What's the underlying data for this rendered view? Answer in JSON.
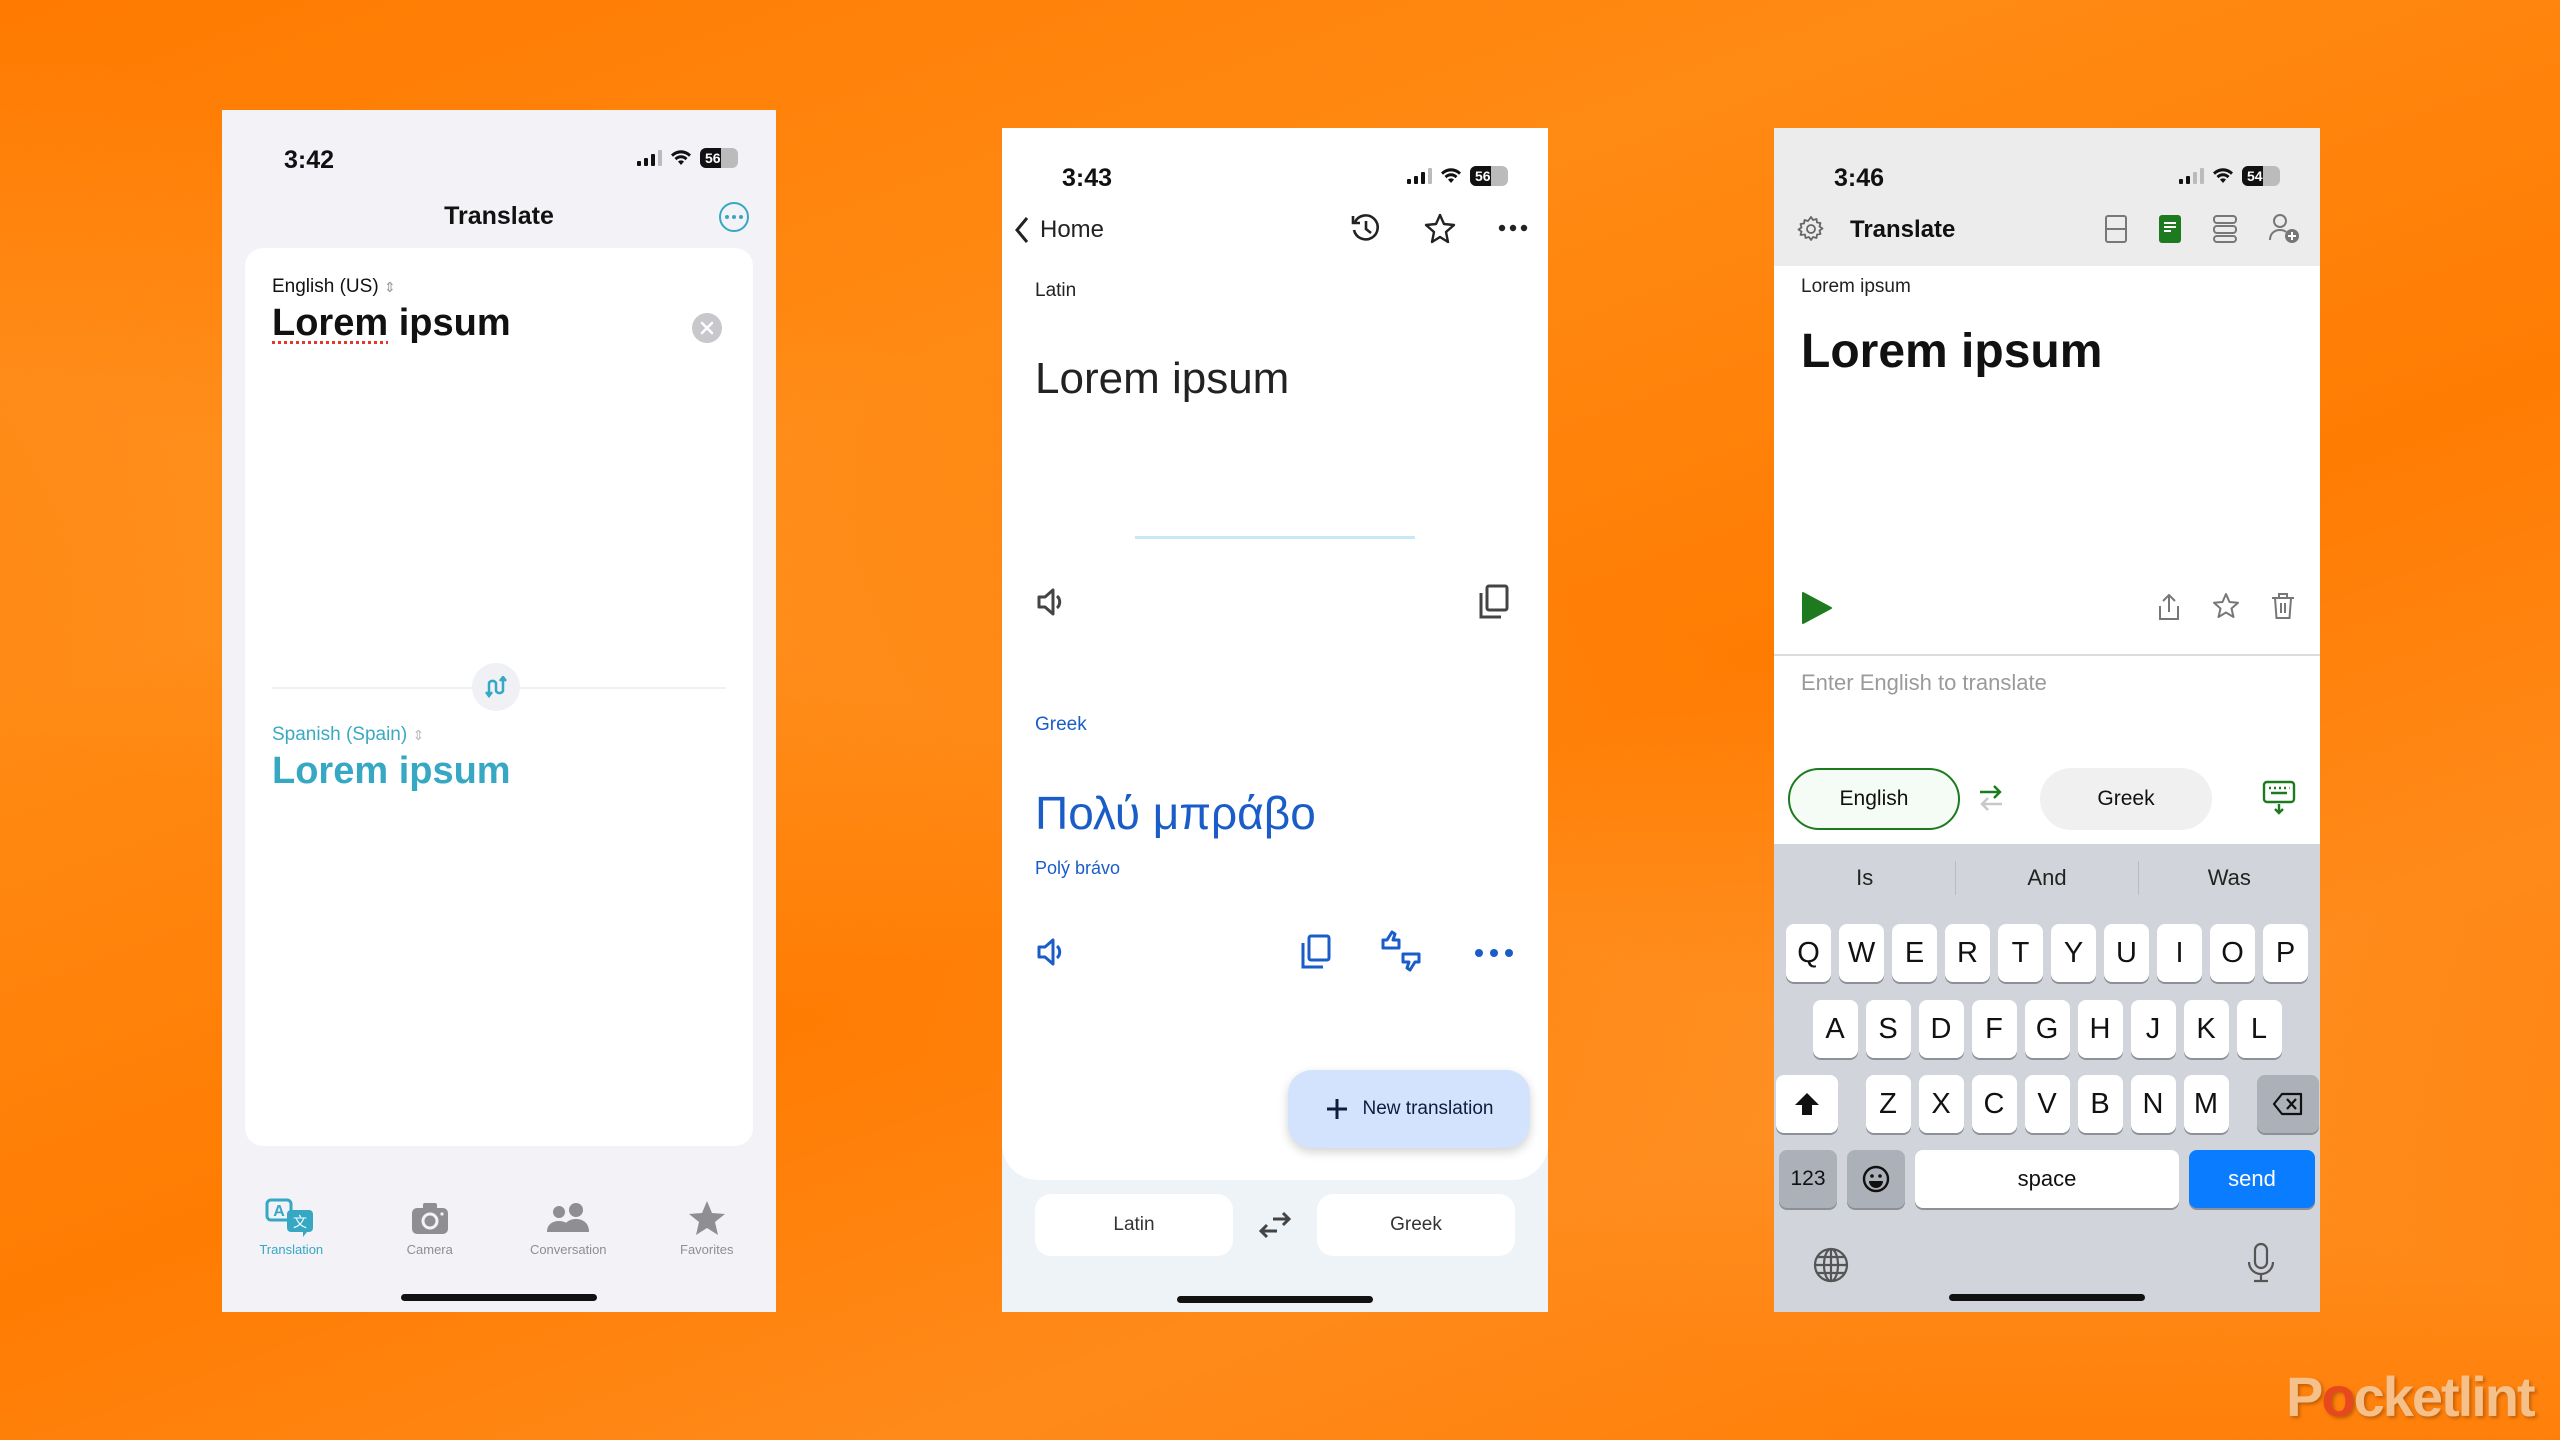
{
  "watermark": {
    "brand_prefix": "P",
    "brand_o": "o",
    "brand_suffix": "cketlint"
  },
  "phone1": {
    "status": {
      "time": "3:42",
      "battery": "56"
    },
    "title": "Translate",
    "source": {
      "language": "English (US)",
      "text_misspelled": "Lorem",
      "text_rest": " ipsum"
    },
    "target": {
      "language": "Spanish (Spain)",
      "text": "Lorem ipsum"
    },
    "tabs": [
      {
        "label": "Translation",
        "icon": "translate-icon",
        "active": true
      },
      {
        "label": "Camera",
        "icon": "camera-icon"
      },
      {
        "label": "Conversation",
        "icon": "conversation-icon"
      },
      {
        "label": "Favorites",
        "icon": "star-icon"
      }
    ],
    "accent_color": "#36a8c4"
  },
  "phone2": {
    "status": {
      "time": "3:43",
      "battery": "56"
    },
    "nav": {
      "back_label": "Home"
    },
    "source": {
      "language": "Latin",
      "text": "Lorem ipsum"
    },
    "target": {
      "language": "Greek",
      "text": "Πολύ μπράβο",
      "transliteration": "Polý brávo"
    },
    "fab_label": "New translation",
    "lang_bar": {
      "source": "Latin",
      "target": "Greek"
    },
    "accent_color": "#1a5cc8"
  },
  "phone3": {
    "status": {
      "time": "3:46",
      "battery": "54"
    },
    "title": "Translate",
    "source": {
      "label": "Lorem ipsum",
      "text": "Lorem ipsum"
    },
    "input": {
      "placeholder": "Enter English to translate"
    },
    "lang_row": {
      "source": "English",
      "target": "Greek"
    },
    "keyboard": {
      "suggestions": [
        "Is",
        "And",
        "Was"
      ],
      "row1": [
        "Q",
        "W",
        "E",
        "R",
        "T",
        "Y",
        "U",
        "I",
        "O",
        "P"
      ],
      "row2": [
        "A",
        "S",
        "D",
        "F",
        "G",
        "H",
        "J",
        "K",
        "L"
      ],
      "row3": [
        "Z",
        "X",
        "C",
        "V",
        "B",
        "N",
        "M"
      ],
      "numbers_label": "123",
      "space_label": "space",
      "send_label": "send"
    },
    "accent_color": "#1e7a1e",
    "send_color": "#0a7cff"
  }
}
